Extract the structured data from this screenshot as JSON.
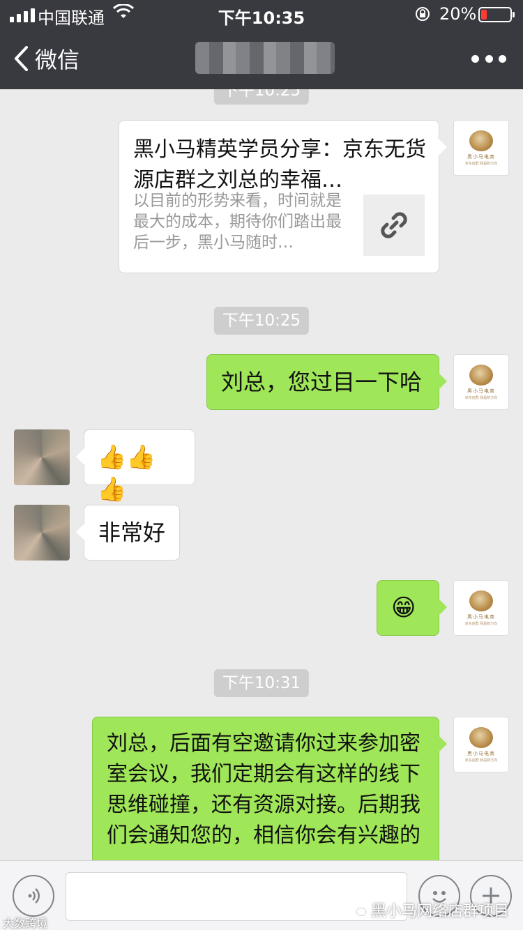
{
  "status_bar": {
    "carrier": "中国联通",
    "time": "下午10:35",
    "battery_percent": "20%",
    "battery_level": 0.2,
    "battery_color": "#ff3b30"
  },
  "nav": {
    "back_label": "微信",
    "back_icon": "chevron-left-icon",
    "more_icon": "more-dots-icon"
  },
  "messages": {
    "card": {
      "title": "黑小马精英学员分享：京东无货源店群之刘总的幸福…",
      "description": "以目前的形势来看，时间就是最大的成本，期待你们踏出最后一步，黑小马随时…",
      "thumb_icon": "link-icon"
    },
    "ts1": "下午10:25",
    "msg1": "刘总，您过目一下哈",
    "msg2_emoji": "👍👍👍",
    "msg3": "非常好",
    "msg4_emoji": "😁",
    "ts2": "下午10:31",
    "msg5": "刘总，后面有空邀请你过来参加密室会议，我们定期会有这样的线下思维碰撞，还有资源对接。后期我们会通知您的，相信你会有兴趣的"
  },
  "avatar_self": {
    "brand": "黑小马电商",
    "sub": "京东店群 我是新方向"
  },
  "input_bar": {
    "voice_icon": "voice-icon",
    "emoji_icon": "emoji-icon",
    "plus_icon": "plus-icon",
    "text_value": ""
  },
  "watermark": {
    "right": "黑小马网络店群项目",
    "left": "大数跨境"
  },
  "colors": {
    "nav_bg": "#393a3f",
    "chat_bg": "#ebebeb",
    "bubble_out": "#9fe658",
    "bubble_in": "#ffffff"
  }
}
